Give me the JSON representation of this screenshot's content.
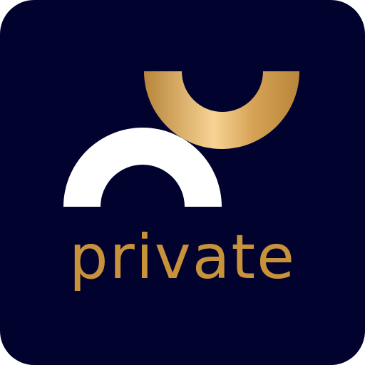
{
  "app_icon": {
    "wordmark": "private",
    "colors": {
      "background": "#02022f",
      "arch": "#ffffff",
      "gold_dark": "#b8853a",
      "gold_light": "#f7d394",
      "wordmark": "#c8923a"
    },
    "icons": [
      "white-arch-icon",
      "gold-cup-icon"
    ]
  }
}
